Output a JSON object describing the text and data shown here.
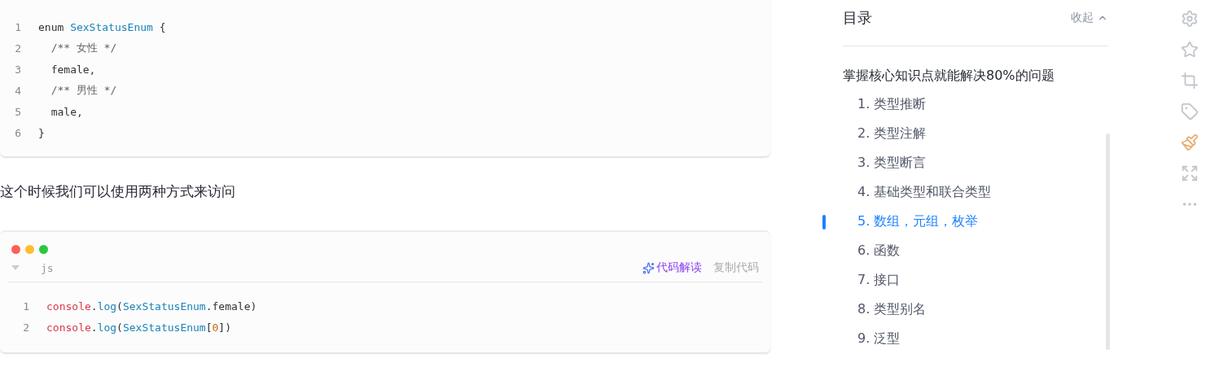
{
  "code_blocks": [
    {
      "kind": "plain",
      "lines": [
        [
          {
            "text": "enum ",
            "kind": "plain"
          },
          {
            "text": "SexStatusEnum",
            "kind": "type"
          },
          {
            "text": " {",
            "kind": "plain"
          }
        ],
        [
          {
            "text": "  /** 女性 */",
            "kind": "comment"
          }
        ],
        [
          {
            "text": "  female,",
            "kind": "plain"
          }
        ],
        [
          {
            "text": "  /** 男性 */",
            "kind": "comment"
          }
        ],
        [
          {
            "text": "  male,",
            "kind": "plain"
          }
        ],
        [
          {
            "text": "}",
            "kind": "plain"
          }
        ]
      ],
      "line_numbers": [
        "1",
        "2",
        "3",
        "4",
        "5",
        "6"
      ]
    },
    {
      "kind": "window",
      "language": "js",
      "explain": "代码解读",
      "copy": "复制代码",
      "lines": [
        [
          {
            "text": "console",
            "kind": "keyword"
          },
          {
            "text": ".",
            "kind": "plain"
          },
          {
            "text": "log",
            "kind": "type"
          },
          {
            "text": "(",
            "kind": "plain"
          },
          {
            "text": "SexStatusEnum",
            "kind": "type"
          },
          {
            "text": ".female)",
            "kind": "plain"
          }
        ],
        [
          {
            "text": "console",
            "kind": "keyword"
          },
          {
            "text": ".",
            "kind": "plain"
          },
          {
            "text": "log",
            "kind": "type"
          },
          {
            "text": "(",
            "kind": "plain"
          },
          {
            "text": "SexStatusEnum",
            "kind": "type"
          },
          {
            "text": "[",
            "kind": "plain"
          },
          {
            "text": "0",
            "kind": "number"
          },
          {
            "text": "])",
            "kind": "plain"
          }
        ]
      ],
      "line_numbers": [
        "1",
        "2"
      ]
    }
  ],
  "paragraph": "这个时候我们可以使用两种方式来访问",
  "toc": {
    "title": "目录",
    "collapse": "收起",
    "heading": "掌握核心知识点就能解决80%的问题",
    "items": [
      {
        "label": "1. 类型推断",
        "selected": false
      },
      {
        "label": "2. 类型注解",
        "selected": false
      },
      {
        "label": "3. 类型断言",
        "selected": false
      },
      {
        "label": "4. 基础类型和联合类型",
        "selected": false
      },
      {
        "label": "5. 数组，元组，枚举",
        "selected": true
      },
      {
        "label": "6. 函数",
        "selected": false
      },
      {
        "label": "7. 接口",
        "selected": false
      },
      {
        "label": "8. 类型别名",
        "selected": false
      },
      {
        "label": "9. 泛型",
        "selected": false
      }
    ]
  }
}
